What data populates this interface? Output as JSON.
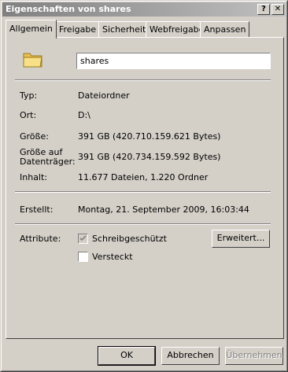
{
  "window": {
    "title": "Eigenschaften von shares"
  },
  "titlebar_buttons": {
    "help": "?",
    "close": "✕"
  },
  "tabs": [
    {
      "label": "Allgemein",
      "active": true
    },
    {
      "label": "Freigabe"
    },
    {
      "label": "Sicherheit"
    },
    {
      "label": "Webfreigabe"
    },
    {
      "label": "Anpassen"
    }
  ],
  "folder": {
    "icon": "folder-icon",
    "name": "shares"
  },
  "properties": {
    "type_label": "Typ:",
    "type_value": "Dateiordner",
    "location_label": "Ort:",
    "location_value": "D:\\",
    "size_label": "Größe:",
    "size_value": "391 GB (420.710.159.621 Bytes)",
    "disk_size_label_line1": "Größe auf",
    "disk_size_label_line2": "Datenträger:",
    "disk_size_value": "391 GB (420.734.159.592 Bytes)",
    "contents_label": "Inhalt:",
    "contents_value": "11.677 Dateien, 1.220 Ordner",
    "created_label": "Erstellt:",
    "created_value": "Montag, 21. September 2009, 16:03:44"
  },
  "attributes": {
    "label": "Attribute:",
    "readonly_label": "Schreibgeschützt",
    "readonly_checked": true,
    "hidden_label": "Versteckt",
    "hidden_checked": false,
    "advanced_button": "Erweitert..."
  },
  "footer": {
    "ok": "OK",
    "cancel": "Abbrechen",
    "apply": "Übernehmen"
  },
  "colors": {
    "face": "#d4d0c8",
    "titlebar_inactive": "#808080"
  }
}
